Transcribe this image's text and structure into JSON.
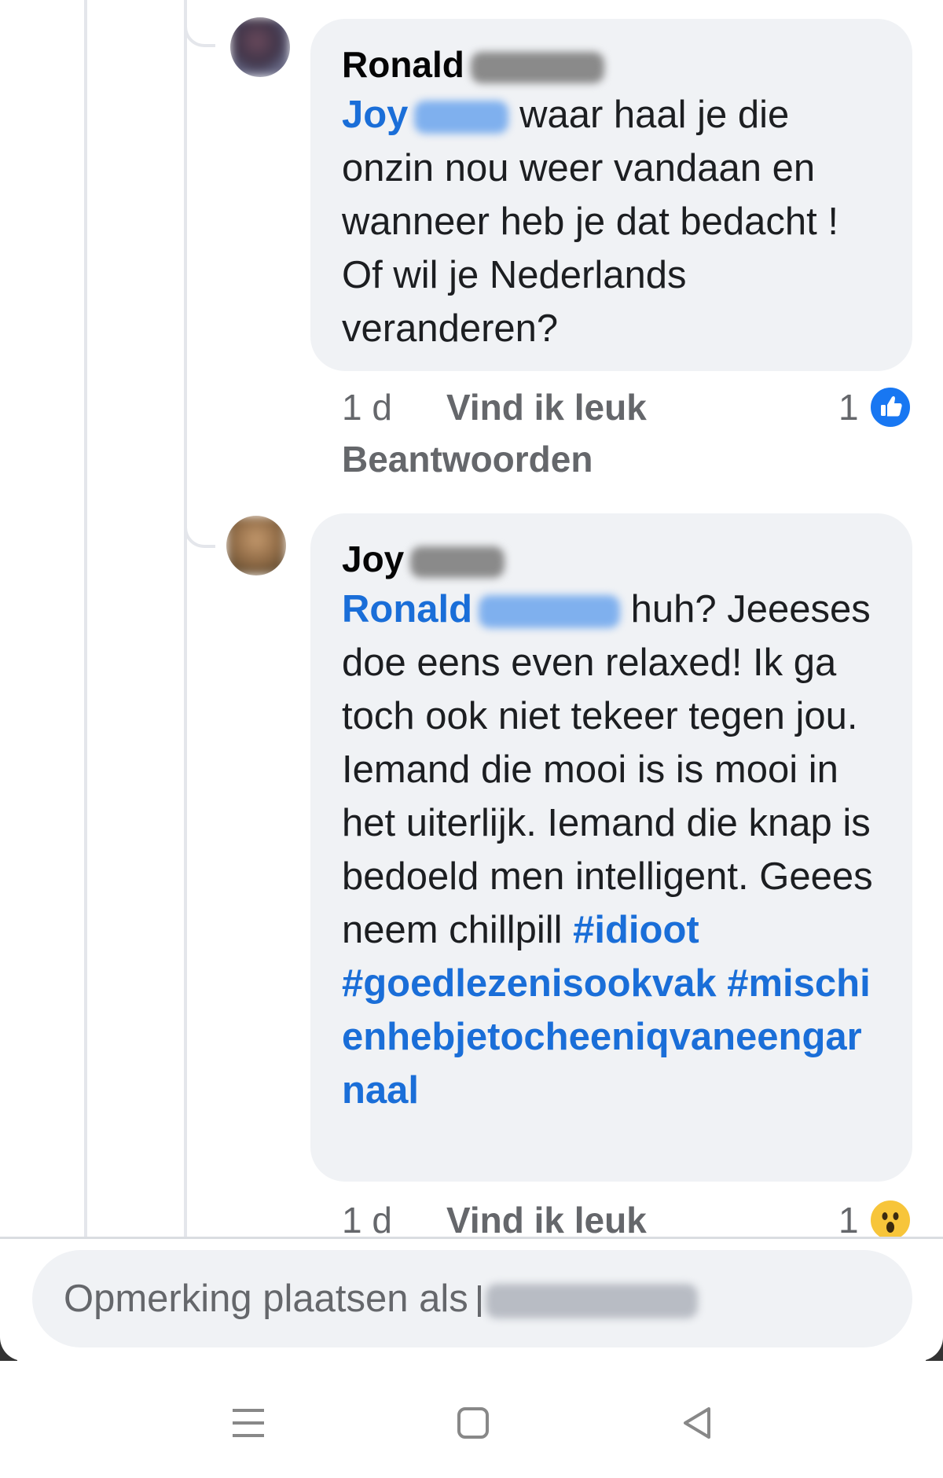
{
  "thread": {
    "comments": [
      {
        "author_first": "Ronald",
        "mention": "Joy",
        "text": "waar haal je die onzin nou weer vandaan en wanneer heb je dat bedacht ! Of wil je Nederlands veranderen?",
        "time": "1 d",
        "like_label": "Vind ik leuk",
        "reply_label": "Beantwoorden",
        "reaction_count": "1",
        "reaction_icon": "like-thumbs-up-icon"
      },
      {
        "author_first": "Joy",
        "mention": "Ronald",
        "text": "huh? Jeeeses doe eens even relaxed! Ik ga toch ook niet tekeer tegen jou. Iemand die mooi is is mooi in het uiterlijk. Iemand die knap is bedoeld men intelligent. Geees neem chillpill",
        "hashtags": [
          "#idioot",
          "#goedlezenisookvak",
          "#mischienhebjetocheeniqvaneengarnaal"
        ],
        "time": "1 d",
        "like_label": "Vind ik leuk",
        "reaction_count": "1",
        "reaction_icon": "wow-face-icon"
      }
    ]
  },
  "composer": {
    "placeholder": "Opmerking plaatsen als"
  },
  "navbar": {
    "icons": [
      "menu-icon",
      "home-square-icon",
      "back-triangle-icon"
    ]
  },
  "colors": {
    "bubble": "#f0f2f5",
    "link": "#1a6ed8",
    "meta": "#65676b",
    "like": "#1877f2",
    "wow": "#f7c53a"
  }
}
